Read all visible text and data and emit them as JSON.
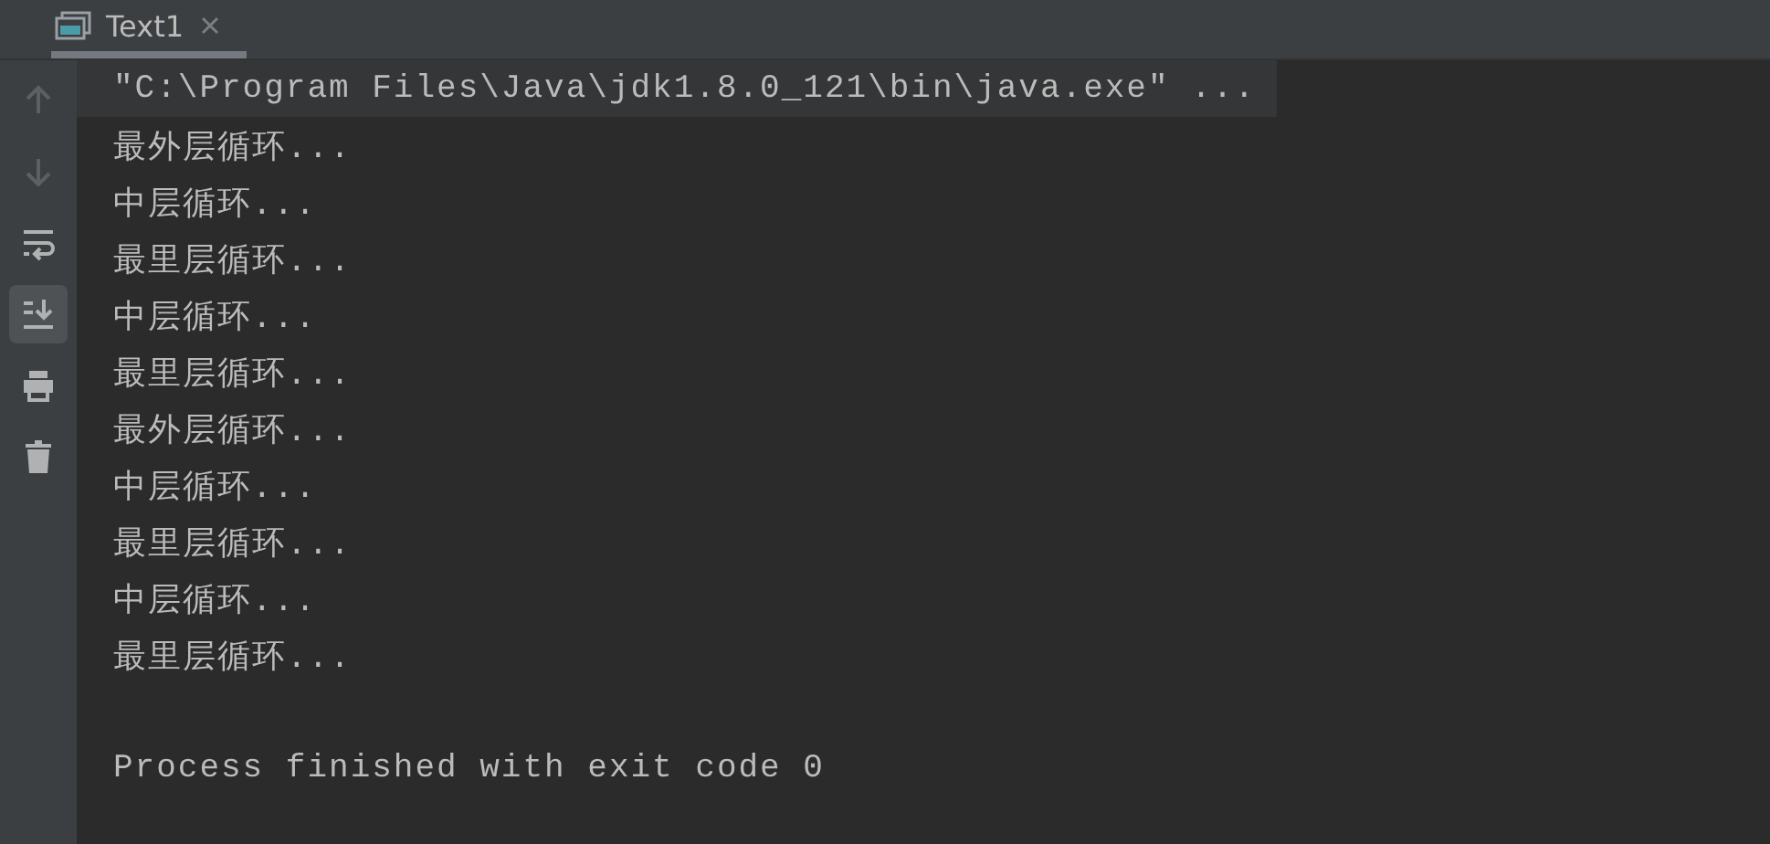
{
  "tab": {
    "label": "Text1",
    "selected": true
  },
  "toolbar": [
    {
      "kind": "up",
      "disabled": true,
      "selected": false
    },
    {
      "kind": "down",
      "disabled": true,
      "selected": false
    },
    {
      "kind": "wrap",
      "disabled": false,
      "selected": false
    },
    {
      "kind": "scroll-end",
      "disabled": false,
      "selected": true
    },
    {
      "kind": "print",
      "disabled": false,
      "selected": false
    },
    {
      "kind": "trash",
      "disabled": false,
      "selected": false
    }
  ],
  "console": [
    {
      "kind": "command",
      "text": "\"C:\\Program Files\\Java\\jdk1.8.0_121\\bin\\java.exe\" ..."
    },
    {
      "kind": "output",
      "text": "最外层循环..."
    },
    {
      "kind": "output",
      "text": "中层循环..."
    },
    {
      "kind": "output",
      "text": "最里层循环..."
    },
    {
      "kind": "output",
      "text": "中层循环..."
    },
    {
      "kind": "output",
      "text": "最里层循环..."
    },
    {
      "kind": "output",
      "text": "最外层循环..."
    },
    {
      "kind": "output",
      "text": "中层循环..."
    },
    {
      "kind": "output",
      "text": "最里层循环..."
    },
    {
      "kind": "output",
      "text": "中层循环..."
    },
    {
      "kind": "output",
      "text": "最里层循环..."
    },
    {
      "kind": "exit",
      "text": "Process finished with exit code 0"
    }
  ]
}
